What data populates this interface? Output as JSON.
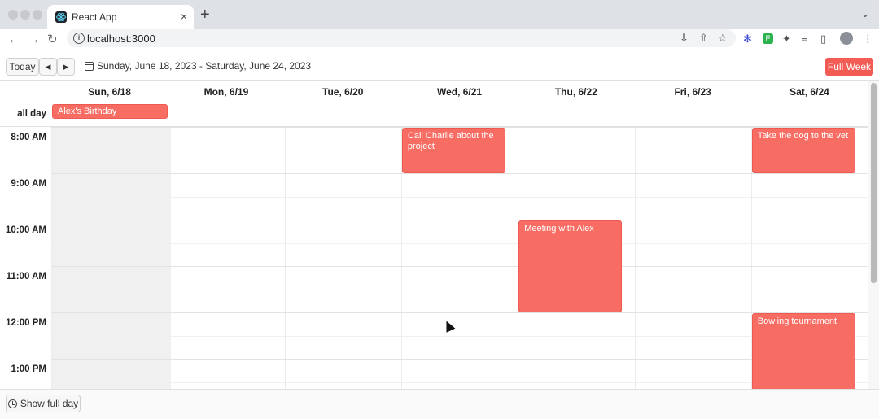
{
  "browser": {
    "tab_title": "React App",
    "tab_close": "×",
    "new_tab": "+",
    "tab_menu": "⌄",
    "url": "localhost:3000",
    "icons": [
      "back-icon",
      "forward-icon",
      "reload-icon",
      "site-info-icon",
      "install-icon",
      "share-icon",
      "bookmark-star-icon",
      "extension-snowflake-icon",
      "extension-f-icon",
      "extensions-puzzle-icon",
      "reading-list-icon",
      "side-panel-icon",
      "profile-avatar",
      "menu-kebab-icon"
    ],
    "ext_f_label": "F"
  },
  "header": {
    "today_label": "Today",
    "prev_label": "◀",
    "next_label": "▶",
    "date_range": "Sunday, June 18, 2023 - Saturday, June 24, 2023",
    "full_week_label": "Full Week",
    "accent_color": "#f25c54"
  },
  "calendar": {
    "days": [
      {
        "label": "Sun, 6/18"
      },
      {
        "label": "Mon, 6/19"
      },
      {
        "label": "Tue, 6/20"
      },
      {
        "label": "Wed, 6/21"
      },
      {
        "label": "Thu, 6/22"
      },
      {
        "label": "Fri, 6/23"
      },
      {
        "label": "Sat, 6/24"
      }
    ],
    "all_day_label": "all day",
    "hours": [
      "8:00 AM",
      "9:00 AM",
      "10:00 AM",
      "11:00 AM",
      "12:00 PM",
      "1:00 PM"
    ],
    "all_day_events": [
      {
        "title": "Alex's Birthday",
        "day": "Sun, 6/18"
      }
    ],
    "events": [
      {
        "title": "Call Charlie about the project",
        "day": "Wed, 6/21",
        "start": "8:00 AM",
        "end": "9:00 AM"
      },
      {
        "title": "Take the dog to the vet",
        "day": "Sat, 6/24",
        "start": "8:00 AM",
        "end": "9:00 AM"
      },
      {
        "title": "Meeting with Alex",
        "day": "Thu, 6/22",
        "start": "10:00 AM",
        "end": "12:00 PM"
      },
      {
        "title": "Bowling tournament",
        "day": "Sat, 6/24",
        "start": "12:00 PM",
        "end": ""
      }
    ],
    "event_color": "#f76c63"
  },
  "footer": {
    "show_full_day_label": "Show full day"
  }
}
